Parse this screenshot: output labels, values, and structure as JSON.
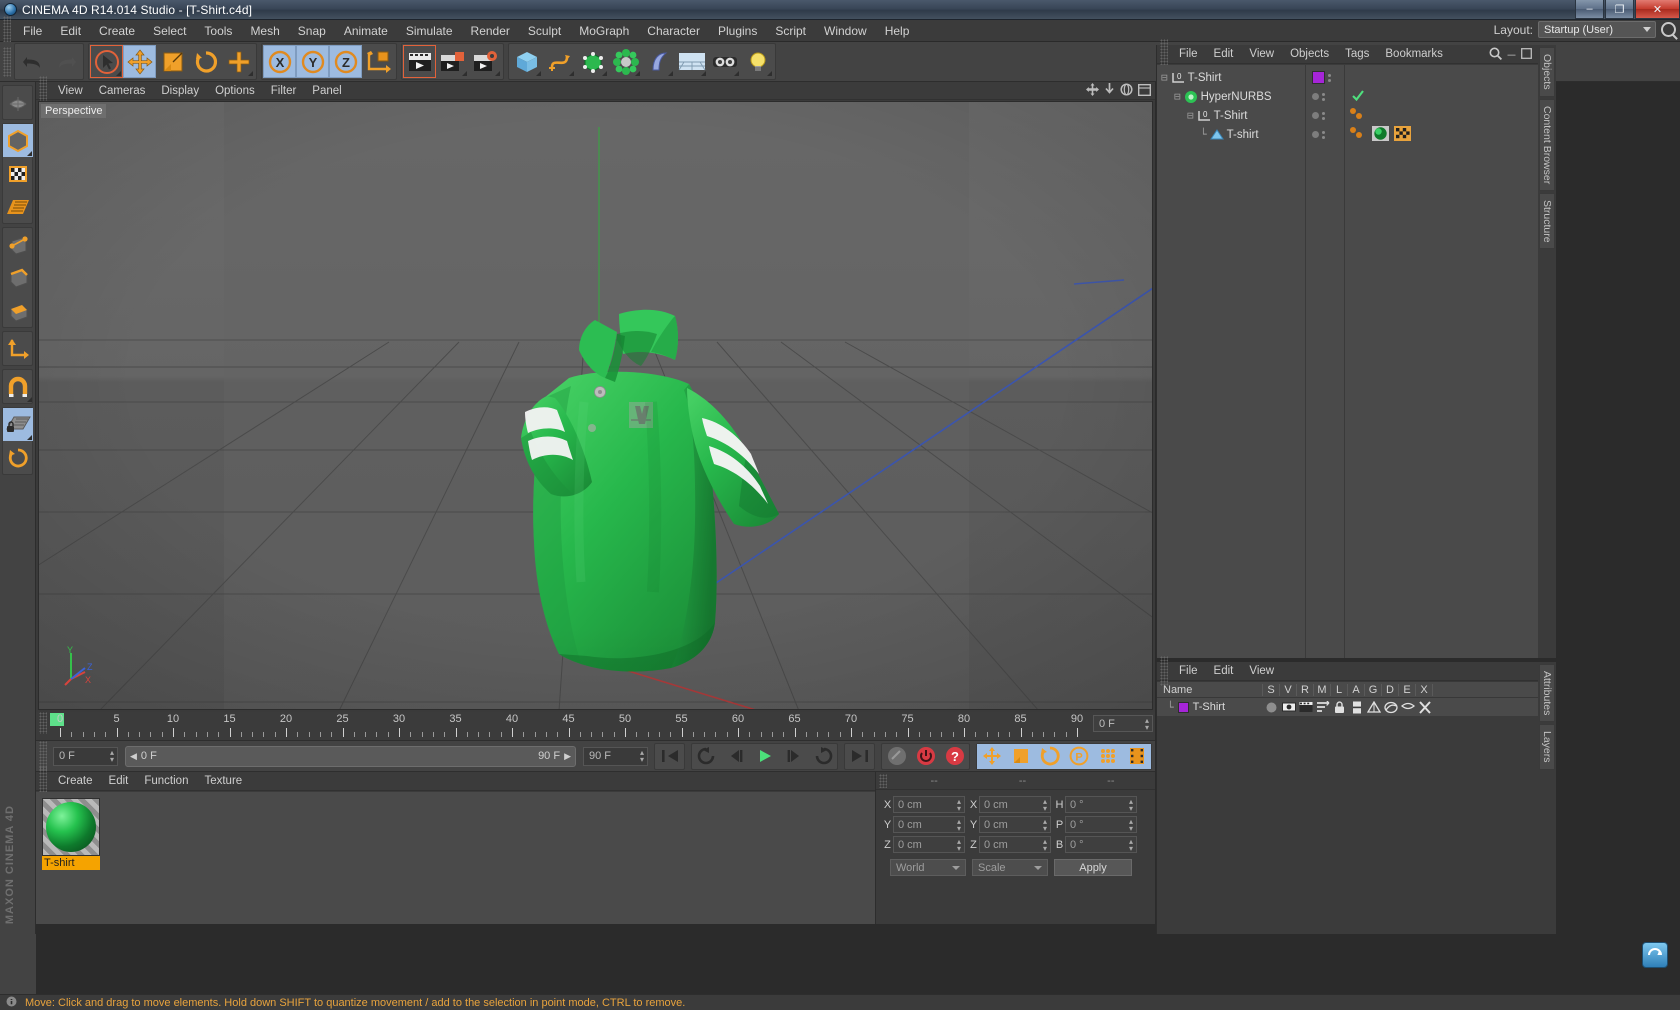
{
  "window": {
    "title": "CINEMA 4D R14.014 Studio - [T-Shirt.c4d]",
    "app_icon": "c4d-logo-icon",
    "minimize": "–",
    "maximize": "❐",
    "close": "✕"
  },
  "menubar": {
    "items": [
      "File",
      "Edit",
      "Create",
      "Select",
      "Tools",
      "Mesh",
      "Snap",
      "Animate",
      "Simulate",
      "Render",
      "Sculpt",
      "MoGraph",
      "Character",
      "Plugins",
      "Script",
      "Window",
      "Help"
    ],
    "layout_label": "Layout:",
    "layout_value": "Startup (User)",
    "search_icon": "magnifier-icon"
  },
  "toolbar": {
    "groups": [
      {
        "name": "history",
        "buttons": [
          {
            "icon": "undo-icon",
            "state": "normal"
          },
          {
            "icon": "redo-icon",
            "state": "disabled"
          }
        ]
      },
      {
        "name": "tools",
        "buttons": [
          {
            "icon": "select-arrow-icon",
            "state": "selected"
          },
          {
            "icon": "move-icon",
            "state": "active"
          },
          {
            "icon": "scale-icon",
            "state": "normal"
          },
          {
            "icon": "rotate-icon",
            "state": "normal"
          },
          {
            "icon": "add-cross-icon",
            "state": "normal"
          }
        ]
      },
      {
        "name": "axis-locks",
        "buttons": [
          {
            "icon": "x-axis-icon",
            "state": "active"
          },
          {
            "icon": "y-axis-icon",
            "state": "active"
          },
          {
            "icon": "z-axis-icon",
            "state": "active"
          },
          {
            "icon": "world-object-axis-icon",
            "state": "normal"
          }
        ]
      },
      {
        "name": "render",
        "buttons": [
          {
            "icon": "render-view-icon",
            "state": "selected"
          },
          {
            "icon": "render-region-icon",
            "state": "normal"
          },
          {
            "icon": "render-settings-icon",
            "state": "normal"
          }
        ]
      },
      {
        "name": "create",
        "buttons": [
          {
            "icon": "cube-primitive-icon",
            "state": "normal"
          },
          {
            "icon": "spline-pen-icon",
            "state": "normal"
          },
          {
            "icon": "generator-nurbs-icon",
            "state": "normal"
          },
          {
            "icon": "array-deformer-icon",
            "state": "normal"
          },
          {
            "icon": "bend-deformer-icon",
            "state": "normal"
          },
          {
            "icon": "floor-environment-icon",
            "state": "normal"
          },
          {
            "icon": "camera-icon",
            "state": "normal"
          },
          {
            "icon": "light-icon",
            "state": "normal"
          }
        ]
      }
    ]
  },
  "lefttoolbar": {
    "groups": [
      [
        {
          "icon": "make-editable-icon",
          "state": "normal"
        }
      ],
      [
        {
          "icon": "model-mode-cube-icon",
          "state": "active"
        },
        {
          "icon": "texture-mode-icon",
          "state": "normal"
        },
        {
          "icon": "uv-mesh-icon",
          "state": "normal"
        }
      ],
      [
        {
          "icon": "points-mode-icon",
          "state": "normal"
        },
        {
          "icon": "edges-mode-icon",
          "state": "normal"
        },
        {
          "icon": "polygons-mode-icon",
          "state": "normal"
        }
      ],
      [
        {
          "icon": "axis-modify-icon",
          "state": "normal"
        }
      ],
      [
        {
          "icon": "magnet-snap-icon",
          "state": "normal"
        }
      ],
      [
        {
          "icon": "workplane-lock-icon",
          "state": "active"
        },
        {
          "icon": "workplane-rotate-icon",
          "state": "normal"
        }
      ]
    ],
    "brand": "MAXON CINEMA 4D"
  },
  "viewport": {
    "menu": [
      "View",
      "Cameras",
      "Display",
      "Options",
      "Filter",
      "Panel"
    ],
    "label": "Perspective",
    "corner_icons": [
      "pan-icon",
      "dolly-icon",
      "orbit-icon",
      "maximize-view-icon"
    ],
    "axis_gizmo": {
      "x": "X",
      "y": "Y",
      "z": "Z"
    },
    "scene_object": "green polo t-shirt with white sleeve stripes"
  },
  "object_manager": {
    "menu": [
      "File",
      "Edit",
      "View",
      "Objects",
      "Tags",
      "Bookmarks"
    ],
    "search_icon": "magnifier-icon",
    "rows": [
      {
        "name": "T-Shirt",
        "indent": 0,
        "icon": "null-object-icon",
        "swatch": "#a625d8",
        "tags": []
      },
      {
        "name": "HyperNURBS",
        "indent": 1,
        "icon": "hypernurbs-icon",
        "swatch": "",
        "tags": [
          "check-green-icon"
        ]
      },
      {
        "name": "T-Shirt",
        "indent": 2,
        "icon": "null-object-icon",
        "swatch": "",
        "tags": []
      },
      {
        "name": "T-shirt",
        "indent": 3,
        "icon": "polygon-object-icon",
        "swatch": "",
        "tags": [
          "material-tag-icon",
          "uvw-tag-icon"
        ]
      }
    ]
  },
  "dock_tabs_right": [
    "Objects",
    "Content Browser",
    "Structure"
  ],
  "dock_tabs_right_lower": [
    "Attributes",
    "Layers"
  ],
  "timeline": {
    "ticks": [
      0,
      5,
      10,
      15,
      20,
      25,
      30,
      35,
      40,
      45,
      50,
      55,
      60,
      65,
      70,
      75,
      80,
      85,
      90
    ],
    "min": 0,
    "max": 90,
    "current_frame_marker": 0,
    "right_field": "0 F"
  },
  "transport": {
    "current_frame": "0 F",
    "range_start": "0 F",
    "range_end": "90 F",
    "end_frame": "90 F",
    "buttons": [
      {
        "icon": "go-to-start-icon",
        "state": "normal"
      },
      {
        "icon": "step-back-keyframe-icon",
        "state": "normal"
      },
      {
        "icon": "step-back-frame-icon",
        "state": "normal"
      },
      {
        "icon": "play-icon",
        "state": "normal"
      },
      {
        "icon": "step-forward-frame-icon",
        "state": "normal"
      },
      {
        "icon": "step-forward-keyframe-icon",
        "state": "normal"
      },
      {
        "icon": "go-to-end-icon",
        "state": "normal"
      },
      {
        "icon": "record-active-objects-icon",
        "state": "disabled"
      },
      {
        "icon": "autokeying-icon",
        "state": "normal"
      },
      {
        "icon": "keyframe-selection-icon",
        "state": "normal"
      },
      {
        "icon": "position-key-icon",
        "state": "active"
      },
      {
        "icon": "scale-key-icon",
        "state": "active"
      },
      {
        "icon": "rotation-key-icon",
        "state": "active"
      },
      {
        "icon": "pla-key-icon",
        "state": "active"
      },
      {
        "icon": "point-level-anim-icon",
        "state": "active"
      },
      {
        "icon": "timeline-filmstrip-icon",
        "state": "active"
      }
    ]
  },
  "material_manager": {
    "menu": [
      "Create",
      "Edit",
      "Function",
      "Texture"
    ],
    "materials": [
      {
        "name": "T-shirt",
        "thumbnail": "green-marble-sphere",
        "selected": true
      }
    ]
  },
  "coordinates": {
    "headers": [
      "--",
      "--",
      "--"
    ],
    "rows": [
      {
        "label_pos": "X",
        "pos": "0 cm",
        "label_size": "X",
        "size": "0 cm",
        "label_rot": "H",
        "rot": "0 °"
      },
      {
        "label_pos": "Y",
        "pos": "0 cm",
        "label_size": "Y",
        "size": "0 cm",
        "label_rot": "P",
        "rot": "0 °"
      },
      {
        "label_pos": "Z",
        "pos": "0 cm",
        "label_size": "Z",
        "size": "0 cm",
        "label_rot": "B",
        "rot": "0 °"
      }
    ],
    "system": "World",
    "mode": "Scale",
    "apply": "Apply"
  },
  "attribute_manager": {
    "menu": [
      "File",
      "Edit",
      "View"
    ],
    "layer_columns": [
      "Name",
      "S",
      "V",
      "R",
      "M",
      "L",
      "A",
      "G",
      "D",
      "E",
      "X"
    ],
    "layer_rows": [
      {
        "name": "T-Shirt",
        "swatch": "#a625d8",
        "icons": [
          "solo-dot-icon",
          "view-icon",
          "render-icon",
          "manager-icon",
          "lock-icon",
          "animation-icon",
          "generators-icon",
          "deformers-icon",
          "expressions-icon",
          "xref-icon"
        ]
      }
    ]
  },
  "statusbar": {
    "icon": "info-icon",
    "message": "Move: Click and drag to move elements. Hold down SHIFT to quantize movement / add to the selection in point mode, CTRL to remove."
  },
  "colors": {
    "accent_orange": "#e8a33d",
    "active_blue": "#9dbbe0",
    "select_red": "#e2623a",
    "layer_purple": "#a625d8",
    "material_highlight": "#f5a300",
    "shirt_green": "#22b84a"
  }
}
